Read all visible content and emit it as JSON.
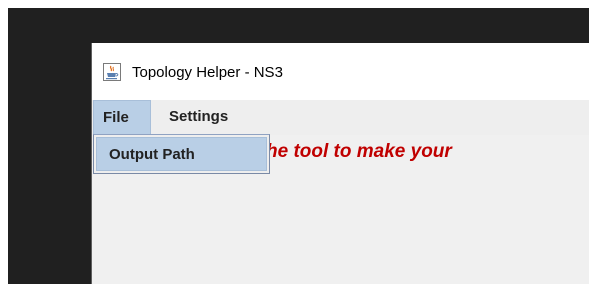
{
  "window": {
    "title": "Topology Helper - NS3",
    "icon": "java-cup-icon"
  },
  "menubar": {
    "items": [
      {
        "label": "File",
        "state": "open"
      },
      {
        "label": "Settings"
      }
    ]
  },
  "file_menu": {
    "items": [
      {
        "label": "Output Path",
        "state": "highlighted"
      }
    ]
  },
  "banner": {
    "text": "he tool to make your"
  },
  "colors": {
    "banner_text": "#c00000",
    "menu_highlight": "#b9cfe6",
    "desktop_background": "#202020"
  }
}
